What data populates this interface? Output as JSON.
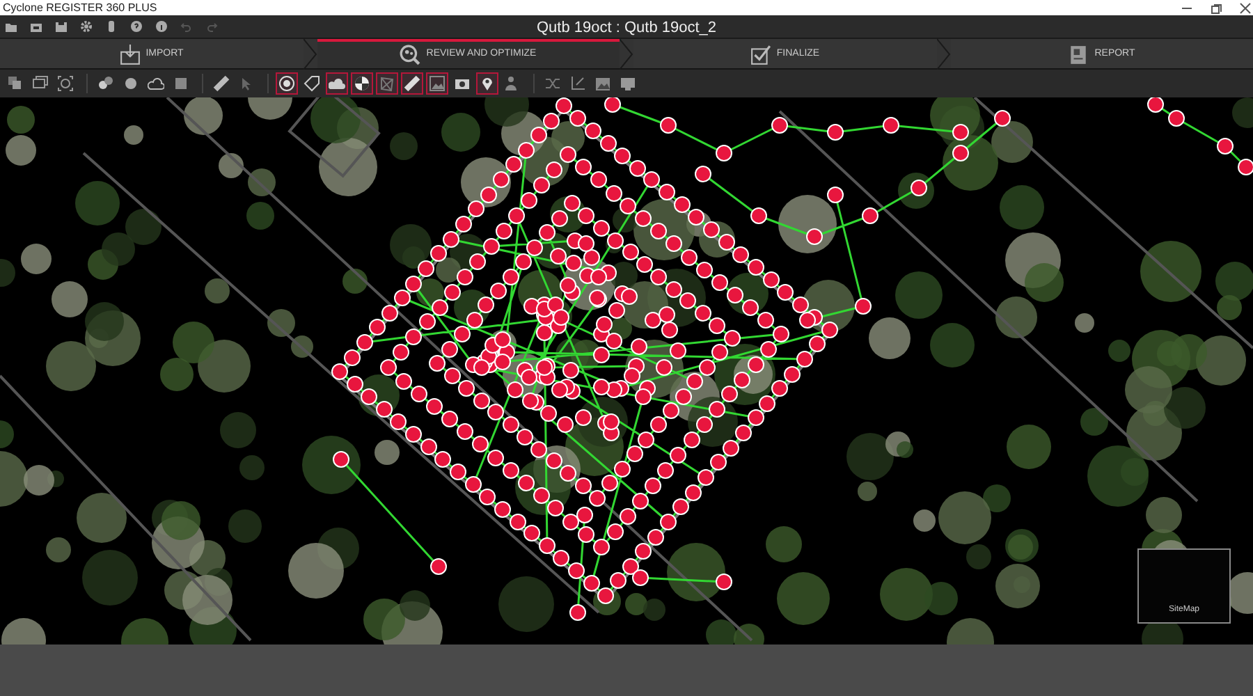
{
  "window": {
    "title": "Cyclone REGISTER 360 PLUS"
  },
  "quick_toolbar": [
    {
      "disabled": false
    },
    {
      "disabled": false
    },
    {
      "disabled": false
    },
    {
      "disabled": false
    },
    {
      "disabled": false
    },
    {
      "disabled": false
    },
    {
      "disabled": false
    },
    {
      "disabled": true
    },
    {
      "disabled": true
    }
  ],
  "project_title": "Qutb 19oct : Qutb 19oct_2",
  "workflow_steps": [
    {
      "label": "IMPORT",
      "selected": false
    },
    {
      "label": "REVIEW AND OPTIMIZE",
      "selected": true
    },
    {
      "label": "FINALIZE",
      "selected": false
    },
    {
      "label": "REPORT",
      "selected": false
    }
  ],
  "tool_groups": [
    [
      {
        "active": false
      },
      {
        "active": false
      },
      {
        "active": false
      }
    ],
    [
      {
        "active": false
      },
      {
        "active": false
      },
      {
        "active": false
      },
      {
        "active": false
      }
    ],
    [
      {
        "active": false
      },
      {
        "active": false
      }
    ],
    [
      {
        "active": true
      },
      {
        "active": false
      },
      {
        "active": true
      },
      {
        "active": true
      },
      {
        "active": true
      },
      {
        "active": true
      },
      {
        "active": true
      },
      {
        "active": false
      },
      {
        "active": true
      },
      {
        "active": false
      }
    ],
    [
      {
        "active": false
      },
      {
        "active": false
      },
      {
        "active": false
      },
      {
        "active": false
      }
    ]
  ],
  "sitemap": {
    "label": "SiteMap"
  }
}
